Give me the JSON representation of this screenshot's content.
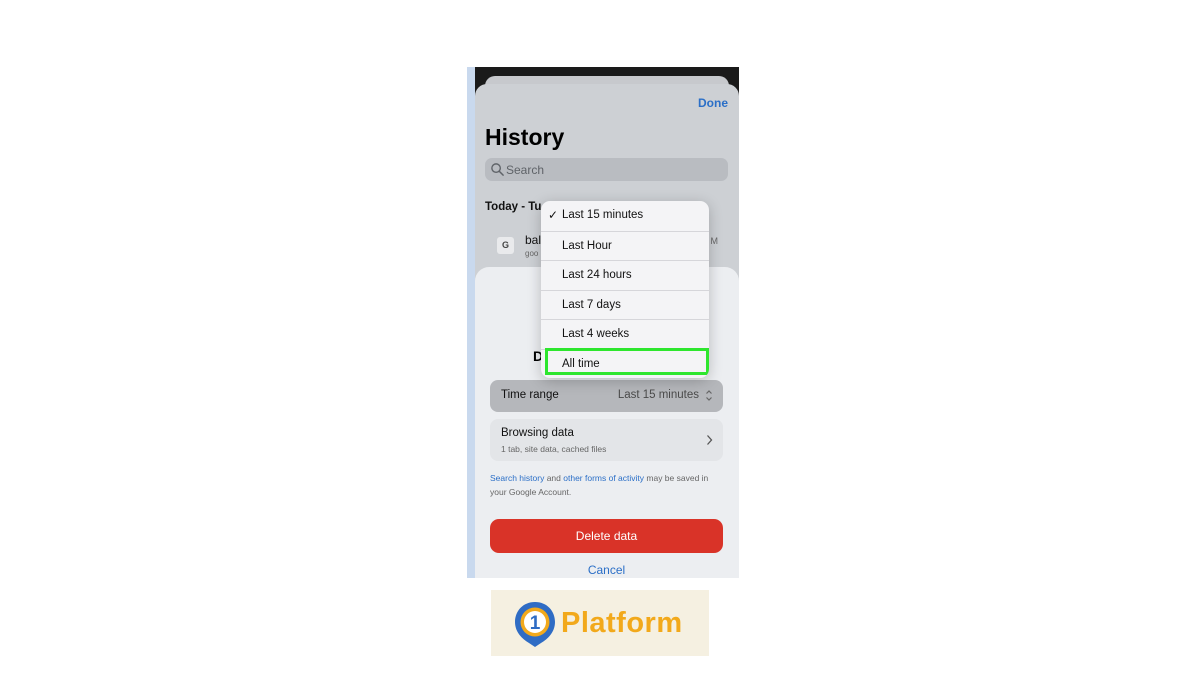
{
  "history": {
    "done_label": "Done",
    "title": "History",
    "search_placeholder": "Search",
    "section_header": "Today - Tu",
    "row": {
      "favicon_letter": "G",
      "title": "bal",
      "subtitle": "goo",
      "time": "M"
    }
  },
  "delete_sheet": {
    "title_fragment": "D",
    "time_range": {
      "label": "Time range",
      "value": "Last 15 minutes"
    },
    "browsing_data": {
      "label": "Browsing data",
      "subtitle": "1 tab, site data, cached files"
    },
    "footnote": {
      "link1": "Search history",
      "text1": " and ",
      "link2": "other forms of activity",
      "text2": " may be saved in your Google Account."
    },
    "delete_label": "Delete data",
    "cancel_label": "Cancel"
  },
  "time_menu": {
    "check_glyph": "✓",
    "options": [
      "Last 15 minutes",
      "Last Hour",
      "Last 24 hours",
      "Last 7 days",
      "Last 4 weeks",
      "All time"
    ],
    "selected_index": 0,
    "highlighted_index": 5
  },
  "logo": {
    "badge_digit": "1",
    "text": "Platform",
    "colors": {
      "blue": "#2f6cc4",
      "orange": "#f2a91b"
    }
  },
  "colors": {
    "link_blue": "#2b6fc7",
    "delete_red": "#d93328",
    "highlight_green": "#2ee62e"
  }
}
